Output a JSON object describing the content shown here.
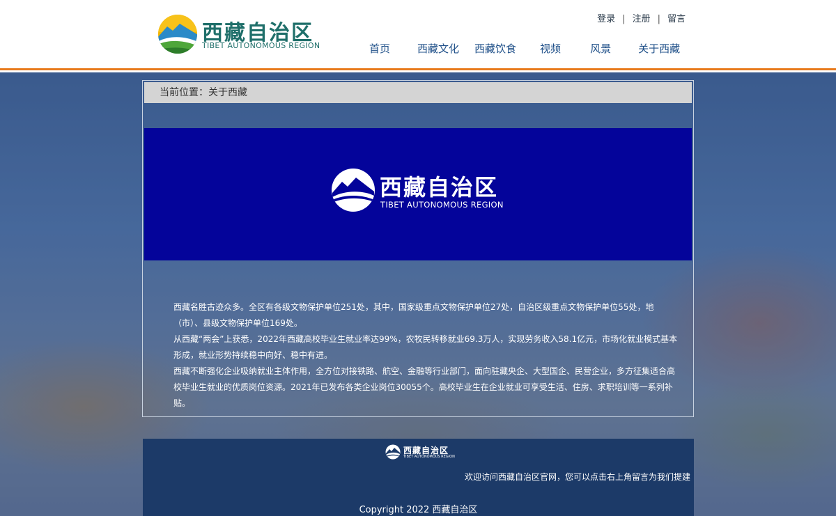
{
  "brand": {
    "title": "西藏自治区",
    "subtitle": "TIBET AUTONOMOUS REGION"
  },
  "toplinks": [
    {
      "label": "登录"
    },
    {
      "label": "注册"
    },
    {
      "label": "留言"
    }
  ],
  "nav": [
    {
      "label": "首页"
    },
    {
      "label": "西藏文化"
    },
    {
      "label": "西藏饮食"
    },
    {
      "label": "视频"
    },
    {
      "label": "风景"
    },
    {
      "label": "关于西藏"
    }
  ],
  "breadcrumb": {
    "text": "当前位置：关于西藏"
  },
  "content": {
    "paragraphs": [
      "西藏名胜古迹众多。全区有各级文物保护单位251处，其中，国家级重点文物保护单位27处，自治区级重点文物保护单位55处，地（市）、县级文物保护单位169处。",
      "从西藏“两会”上获悉，2022年西藏高校毕业生就业率达99%，农牧民转移就业69.3万人，实现劳务收入58.1亿元，市场化就业模式基本形成，就业形势持续稳中向好、稳中有进。",
      "西藏不断强化企业吸纳就业主体作用，全方位对接铁路、航空、金融等行业部门，面向驻藏央企、大型国企、民营企业，多方征集适合高校毕业生就业的优质岗位资源。2021年已发布各类企业岗位30055个。高校毕业生在企业就业可享受生活、住房、求职培训等一系列补贴。"
    ]
  },
  "footer": {
    "message": "欢迎访问西藏自治区官网，您可以点击右上角留言为我们提建",
    "copyright": "Copyright 2022 西藏自治区"
  },
  "colors": {
    "accent": "#e87a1c",
    "banner": "#04049a",
    "footer": "#1c3a68",
    "brand_green": "#1f6f6a"
  }
}
